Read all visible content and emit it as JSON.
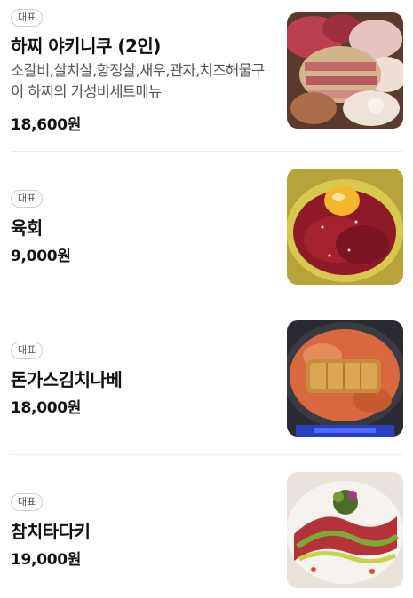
{
  "menu": {
    "items": [
      {
        "badge": "대표",
        "name": "하찌 야키니쿠 (2인)",
        "description": "소갈비,살치살,항정살,새우,관자,치즈해물구이 하찌의 가성비세트메뉴",
        "price": "18,600원",
        "image": "grilled-meat-platter-photo"
      },
      {
        "badge": "대표",
        "name": "육회",
        "price": "9,000원",
        "image": "beef-tartare-photo"
      },
      {
        "badge": "대표",
        "name": "돈가스김치나베",
        "price": "18,000원",
        "image": "pork-cutlet-kimchi-hotpot-photo"
      },
      {
        "badge": "대표",
        "name": "참치타다키",
        "price": "19,000원",
        "image": "tuna-tataki-photo"
      }
    ]
  }
}
